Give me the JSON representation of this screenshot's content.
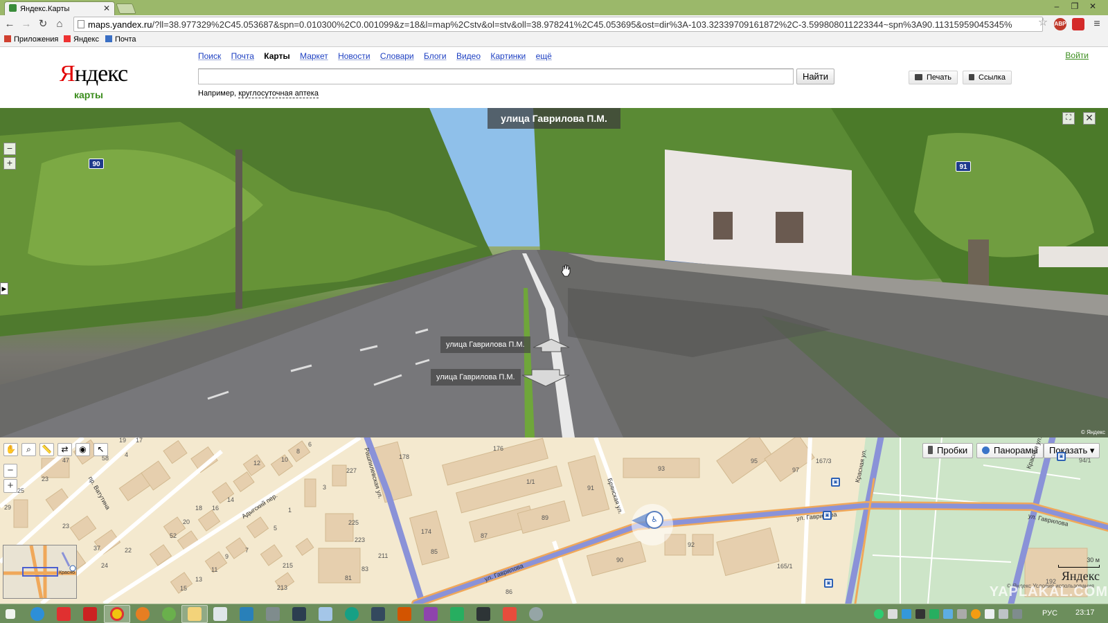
{
  "browser": {
    "tab_title": "Яндекс.Карты",
    "url_host": "maps.yandex.ru",
    "url_rest": "/?ll=38.977329%2C45.053687&spn=0.010300%2C0.001099&z=18&l=map%2Cstv&ol=stv&oll=38.978241%2C45.053695&ost=dir%3A-103.32339709161872%2C-3.599808011223344~spn%3A90.11315959045345%",
    "bookmarks": [
      "Приложения",
      "Яндекс",
      "Почта"
    ],
    "extensions": [
      "ABP"
    ]
  },
  "header": {
    "logo_first": "Я",
    "logo_rest": "ндекс",
    "logo_sub": "карты",
    "services": [
      "Поиск",
      "Почта",
      "Карты",
      "Маркет",
      "Новости",
      "Словари",
      "Блоги",
      "Видео",
      "Картинки",
      "ещё"
    ],
    "current_service": "Карты",
    "search_value": "",
    "search_button": "Найти",
    "example_prefix": "Например,",
    "example_query": "круглосуточная аптека",
    "print_button": "Печать",
    "link_button": "Ссылка",
    "login": "Войти"
  },
  "panorama": {
    "street_title": "улица Гаврилова П.М.",
    "arrow_forward_label": "улица Гаврилова П.М.",
    "arrow_back_label": "улица Гаврилова П.М.",
    "shield_left": "90",
    "shield_right": "91",
    "copyright": "© Яндекс"
  },
  "map": {
    "buttons": [
      "Пробки",
      "Панорамы",
      "Показать ▾"
    ],
    "streets": [
      "Рашпилевская ул.",
      "Брянская ул.",
      "ул. Гаврилова",
      "ул. Гаврилова",
      "ул. Гаврилова",
      "Адыгский пер.",
      "пр. Ватутина",
      "Красная ул.",
      "Красная ул."
    ],
    "house_numbers": [
      "19",
      "17",
      "21",
      "4",
      "47",
      "58",
      "12",
      "10",
      "8",
      "6",
      "4",
      "227",
      "23",
      "25",
      "29",
      "18",
      "16",
      "14",
      "3",
      "1",
      "20",
      "52",
      "5",
      "23",
      "37",
      "22",
      "9",
      "7",
      "225",
      "223",
      "211",
      "215",
      "24",
      "11",
      "13",
      "15",
      "81",
      "83",
      "213",
      "178",
      "176",
      "1/1",
      "91",
      "89",
      "87",
      "174",
      "85",
      "93",
      "95",
      "97",
      "167/3",
      "94/1",
      "92",
      "90",
      "165/1",
      "86",
      "192"
    ],
    "scale": "30 м",
    "brand": "Яндекс",
    "terms": "© Яндекс  Условия использования",
    "minimap_label": "Красно",
    "watermark": "YAPLAKAL.COM"
  },
  "taskbar": {
    "language": "РУС",
    "time": "23:17"
  },
  "colors": {
    "accent_green": "#3a8c1c",
    "link_blue": "#1a3dc1",
    "logo_red": "#e10000",
    "road_blue": "#8a92d8",
    "road_orange": "#f0a85a",
    "map_bg": "#f4e9cf"
  }
}
